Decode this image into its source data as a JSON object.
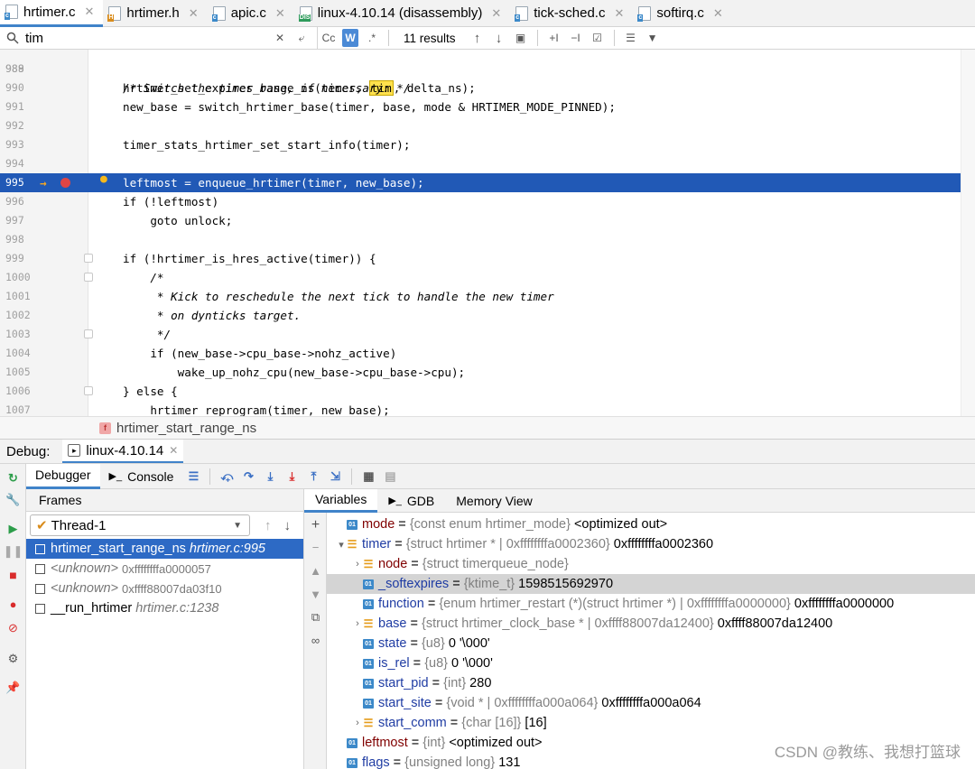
{
  "tabs": [
    {
      "label": "hrtimer.c",
      "badge": "c",
      "badge_color": "#3c89c9",
      "active": true
    },
    {
      "label": "hrtimer.h",
      "badge": "H",
      "badge_color": "#d98c1c",
      "active": false
    },
    {
      "label": "apic.c",
      "badge": "c",
      "badge_color": "#3c89c9",
      "active": false
    },
    {
      "label": "linux-4.10.14 (disassembly)",
      "badge": "DIS",
      "badge_color": "#2e9b5b",
      "active": false
    },
    {
      "label": "tick-sched.c",
      "badge": "c",
      "badge_color": "#3c89c9",
      "active": false
    },
    {
      "label": "softirq.c",
      "badge": "c",
      "badge_color": "#3c89c9",
      "active": false
    }
  ],
  "search": {
    "value": "tim",
    "match_case": "Cc",
    "words": "W",
    "regex": ".*",
    "results": "11 results"
  },
  "editor": {
    "partial_top": "hrtimer_set_expires_range_ns(timer, tim, delta_ns);",
    "lines": [
      {
        "n": "989",
        "code": ""
      },
      {
        "n": "990",
        "code": "/* Switch the timer base, if necessary: */"
      },
      {
        "n": "991",
        "code": "new_base = switch_hrtimer_base(timer, base, mode & HRTIMER_MODE_PINNED);"
      },
      {
        "n": "992",
        "code": ""
      },
      {
        "n": "993",
        "code": "timer_stats_hrtimer_set_start_info(timer);"
      },
      {
        "n": "994",
        "code": ""
      },
      {
        "n": "995",
        "code": "leftmost = enqueue_hrtimer(timer, new_base);"
      },
      {
        "n": "996",
        "code": "if (!leftmost)"
      },
      {
        "n": "997",
        "code": "    goto unlock;"
      },
      {
        "n": "998",
        "code": ""
      },
      {
        "n": "999",
        "code": "if (!hrtimer_is_hres_active(timer)) {"
      },
      {
        "n": "1000",
        "code": "    /*"
      },
      {
        "n": "1001",
        "code": "     * Kick to reschedule the next tick to handle the new timer"
      },
      {
        "n": "1002",
        "code": "     * on dynticks target."
      },
      {
        "n": "1003",
        "code": "     */"
      },
      {
        "n": "1004",
        "code": "    if (new_base->cpu_base->nohz_active)"
      },
      {
        "n": "1005",
        "code": "        wake_up_nohz_cpu(new_base->cpu_base->cpu);"
      },
      {
        "n": "1006",
        "code": "} else {"
      },
      {
        "n": "1007",
        "code": "    hrtimer_reprogram(timer, new_base);"
      }
    ]
  },
  "breadcrumb": {
    "badge": "f",
    "label": "hrtimer_start_range_ns"
  },
  "debug": {
    "title": "Debug:",
    "session": "linux-4.10.14",
    "tab_debugger": "Debugger",
    "tab_console": "Console",
    "frames_label": "Frames",
    "thread": "Thread-1",
    "frames": [
      {
        "name": "hrtimer_start_range_ns",
        "loc": "hrtimer.c:995",
        "selected": true
      },
      {
        "name": "<unknown>",
        "loc": "0xffffffffa0000057",
        "selected": false
      },
      {
        "name": "<unknown>",
        "loc": "0xffff88007da03f10",
        "selected": false
      },
      {
        "name": "__run_hrtimer",
        "loc": "hrtimer.c:1238",
        "selected": false
      }
    ],
    "tab_variables": "Variables",
    "tab_gdb": "GDB",
    "tab_memory": "Memory View",
    "variables": [
      {
        "indent": 0,
        "arrow": "",
        "icon": "01",
        "name": "mode",
        "eq": " = ",
        "type": "{const enum hrtimer_mode}",
        "value": " <optimized out>",
        "blue": false,
        "sel": false
      },
      {
        "indent": 0,
        "arrow": "▾",
        "icon": "struct",
        "name": "timer",
        "eq": " = ",
        "type": "{struct hrtimer * | 0xffffffffa0002360}",
        "value": " 0xffffffffa0002360",
        "blue": true,
        "sel": false
      },
      {
        "indent": 1,
        "arrow": "›",
        "icon": "struct",
        "name": "node",
        "eq": " = ",
        "type": "{struct timerqueue_node}",
        "value": "",
        "blue": false,
        "sel": false
      },
      {
        "indent": 1,
        "arrow": "",
        "icon": "01",
        "name": "_softexpires",
        "eq": " = ",
        "type": "{ktime_t}",
        "value": " 1598515692970",
        "blue": true,
        "sel": true
      },
      {
        "indent": 1,
        "arrow": "",
        "icon": "01",
        "name": "function",
        "eq": " = ",
        "type": "{enum hrtimer_restart (*)(struct hrtimer *) | 0xffffffffa0000000}",
        "value": " 0xffffffffa0000000",
        "blue": true,
        "sel": false
      },
      {
        "indent": 1,
        "arrow": "›",
        "icon": "struct",
        "name": "base",
        "eq": " = ",
        "type": "{struct hrtimer_clock_base * | 0xffff88007da12400}",
        "value": " 0xffff88007da12400",
        "blue": true,
        "sel": false
      },
      {
        "indent": 1,
        "arrow": "",
        "icon": "01",
        "name": "state",
        "eq": " = ",
        "type": "{u8}",
        "value": " 0 '\\000'",
        "blue": true,
        "sel": false
      },
      {
        "indent": 1,
        "arrow": "",
        "icon": "01",
        "name": "is_rel",
        "eq": " = ",
        "type": "{u8}",
        "value": " 0 '\\000'",
        "blue": true,
        "sel": false
      },
      {
        "indent": 1,
        "arrow": "",
        "icon": "01",
        "name": "start_pid",
        "eq": " = ",
        "type": "{int}",
        "value": " 280",
        "blue": true,
        "sel": false
      },
      {
        "indent": 1,
        "arrow": "",
        "icon": "01",
        "name": "start_site",
        "eq": " = ",
        "type": "{void * | 0xffffffffa000a064}",
        "value": " 0xffffffffa000a064",
        "blue": true,
        "sel": false
      },
      {
        "indent": 1,
        "arrow": "›",
        "icon": "struct",
        "name": "start_comm",
        "eq": " = ",
        "type": "{char [16]}",
        "value": " [16]",
        "blue": true,
        "sel": false
      },
      {
        "indent": 0,
        "arrow": "",
        "icon": "01",
        "name": "leftmost",
        "eq": " = ",
        "type": "{int}",
        "value": " <optimized out>",
        "blue": false,
        "sel": false
      },
      {
        "indent": 0,
        "arrow": "",
        "icon": "01",
        "name": "flags",
        "eq": " = ",
        "type": "{unsigned long}",
        "value": " 131",
        "blue": true,
        "sel": false
      }
    ]
  },
  "watermark": "CSDN @教练、我想打篮球"
}
